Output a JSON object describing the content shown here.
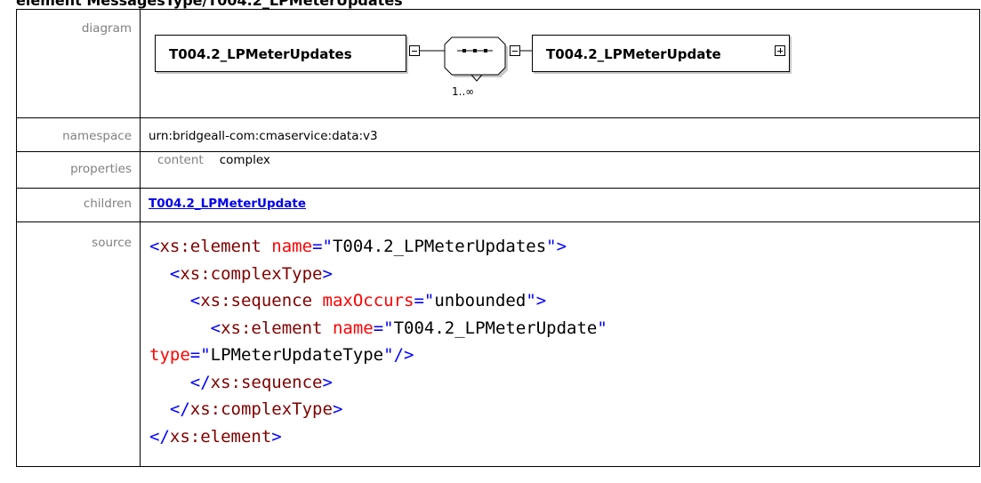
{
  "header": {
    "title": "element MessagesType/T004.2_LPMeterUpdates"
  },
  "rows": {
    "diagram_label": "diagram",
    "namespace_label": "namespace",
    "properties_label": "properties",
    "children_label": "children",
    "source_label": "source"
  },
  "diagram": {
    "element_name": "T004.2_LPMeterUpdates",
    "child_name": "T004.2_LPMeterUpdate",
    "occurrence": "1..∞"
  },
  "namespace": "urn:bridgeall-com:cmaservice:data:v3",
  "properties": {
    "key": "content",
    "value": "complex"
  },
  "children": {
    "link": "T004.2_LPMeterUpdate"
  },
  "source": {
    "line1_open": "<",
    "line1_el": "xs:element",
    "line1_attr": "name",
    "line1_eq": "=\"",
    "line1_val": "T004.2_LPMeterUpdates",
    "line1_close": "\">",
    "line2_open": "<",
    "line2_el": "xs:complexType",
    "line2_close": ">",
    "line3_open": "<",
    "line3_el": "xs:sequence",
    "line3_attr": "maxOccurs",
    "line3_eq": "=\"",
    "line3_val": "unbounded",
    "line3_close": "\">",
    "line4_open": "<",
    "line4_el": "xs:element",
    "line4_attr": "name",
    "line4_eq": "=\"",
    "line4_val": "T004.2_LPMeterUpdate",
    "line4_close": "\"",
    "line5_attr": "type",
    "line5_eq": "=\"",
    "line5_val": "LPMeterUpdateType",
    "line5_close": "\"/>",
    "line6_open": "</",
    "line6_el": "xs:sequence",
    "line6_close": ">",
    "line7_open": "</",
    "line7_el": "xs:complexType",
    "line7_close": ">",
    "line8_open": "</",
    "line8_el": "xs:element",
    "line8_close": ">"
  }
}
